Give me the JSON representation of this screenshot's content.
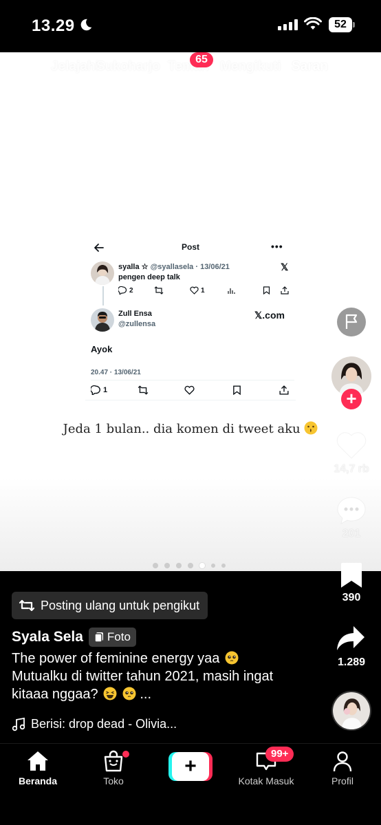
{
  "status_bar": {
    "time": "13.29",
    "battery": "52"
  },
  "top_nav": {
    "tabs": [
      "Jelajahi",
      "Sukoharjo",
      "Teman",
      "Mengikuti",
      "Saran"
    ],
    "teman_badge": "65"
  },
  "tweet": {
    "header_title": "Post",
    "original": {
      "name": "syalla ☆",
      "handle": "@syallasela · 13/06/21",
      "text": "pengen deep talk",
      "replies": "2",
      "likes": "1"
    },
    "reply": {
      "name": "Zull Ensa",
      "handle": "@zullensa",
      "source": "𝕏.com",
      "text": "Ayok",
      "datetime": "20.47 · 13/06/21",
      "replies": "1"
    }
  },
  "overlay_caption": "Jeda 1 bulan.. dia komen di tweet aku",
  "right_rail": {
    "likes": "14,7 rb",
    "comments": "201",
    "bookmarks": "390",
    "shares": "1.289"
  },
  "post_info": {
    "repost_label": "Posting ulang untuk pengikut",
    "author": "Syala Sela",
    "type_badge": "Foto",
    "description": "The power of feminine energy yaa",
    "description_2": "Mutualku di twitter tahun 2021, masih ingat kitaaa nggaa?",
    "ellipsis": "...",
    "music": "Berisi: drop dead - Olivia..."
  },
  "bottom_nav": {
    "home": "Beranda",
    "shop": "Toko",
    "inbox": "Kotak Masuk",
    "inbox_badge": "99+",
    "profile": "Profil"
  },
  "colors": {
    "accent": "#fe2c55",
    "cyan": "#25f4ee"
  }
}
